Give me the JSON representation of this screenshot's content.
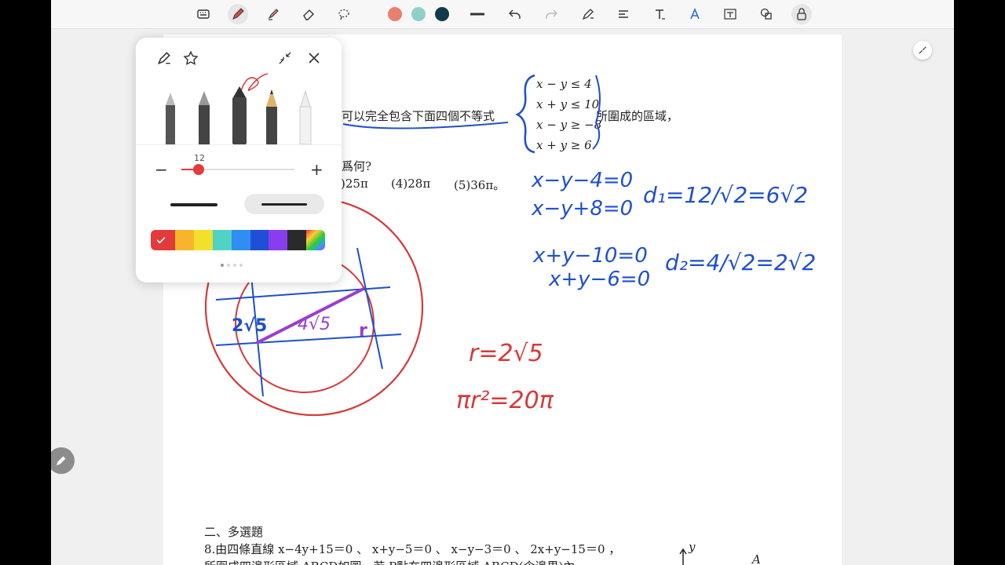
{
  "toolbar": {
    "tools": [
      "keyboard-icon",
      "pen-icon",
      "highlighter-icon",
      "eraser-icon",
      "lasso-icon"
    ],
    "colors": [
      "#e8806e",
      "#8fd0c6",
      "#123a4a"
    ],
    "right_tools": [
      "stroke-width-icon",
      "undo-icon",
      "redo-icon",
      "shape-pen-icon",
      "text-align-icon",
      "text-icon",
      "handwriting-icon",
      "text-box-icon",
      "shapes-icon",
      "lock-icon"
    ]
  },
  "panel": {
    "size_value": "12",
    "size_fraction": 0.15,
    "palette": [
      "#e23b3b",
      "#f7b52c",
      "#f2e02b",
      "#4fd3c4",
      "#2f8ef2",
      "#1f4fd6",
      "#8a3cf0",
      "#2a2a2a",
      "#rainbow"
    ]
  },
  "worksheet": {
    "q1_text": "可以完全包含下面四個不等式",
    "q1_tail": "所圍成的區域，",
    "ineq": [
      "x − y ≤ 4",
      "x + y ≤ 10",
      "x − y ≥ −8",
      "x + y ≥ 6"
    ],
    "q1_line2": "爲何?",
    "options": [
      ")25π",
      "(4)28π",
      "(5)36π。"
    ],
    "section": "二、多選題",
    "q8_line1": "8.由四條直線 x−4y+15＝0 、 x+y−5＝0 、 x−y−3＝0 、 2x+y−15＝0 ，",
    "q8_line2": "所圍成四邊形區域 ABCD如圖，若 P點在四邊形區域 ABCD(含邊界)內",
    "axis_y": "y",
    "axis_a": "A"
  },
  "handwriting": {
    "blue": [
      "x−y−4=0",
      "x−y+8=0",
      "d₁=12/√2=6√2",
      "x+y−10=0",
      "x+y−6=0",
      "d₂=4/√2=2√2"
    ],
    "red": [
      "r=2√5",
      "πr²=20π"
    ],
    "figure": [
      "2√5",
      "4√5",
      "r"
    ]
  }
}
